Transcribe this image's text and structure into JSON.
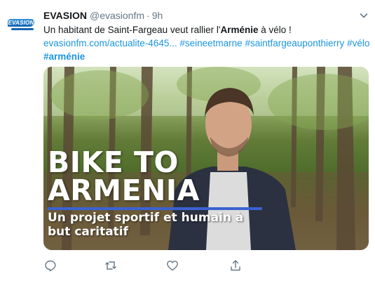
{
  "tweet": {
    "display_name": "EVASION",
    "handle": "@evasionfm",
    "separator": "·",
    "time": "9h",
    "avatar_logo": "EVASION",
    "text": {
      "line1_prefix": "Un habitant de Saint-Fargeau veut rallier l'",
      "line1_bold": "Arménie",
      "line1_suffix": " à vélo !",
      "link": "evasionfm.com/actualite-4645...",
      "hashtags_line2": [
        "#seineetmarne",
        "#saintfargeauponthierry",
        "#vélo"
      ],
      "hashtag_line3": "#arménie"
    },
    "media": {
      "title_line1": "BIKE TO",
      "title_line2": "ARMENIA",
      "subtitle": "Un projet sportif et humain à but caritatif"
    }
  },
  "actions": [
    {
      "name": "reply",
      "icon": "reply-icon"
    },
    {
      "name": "retweet",
      "icon": "retweet-icon"
    },
    {
      "name": "like",
      "icon": "heart-icon"
    },
    {
      "name": "share",
      "icon": "share-icon"
    }
  ],
  "colors": {
    "link": "#1b95e0",
    "muted": "#657786",
    "text": "#14171a",
    "overlay_bar": "#3b62d1",
    "brand_blue": "#1565b0"
  }
}
